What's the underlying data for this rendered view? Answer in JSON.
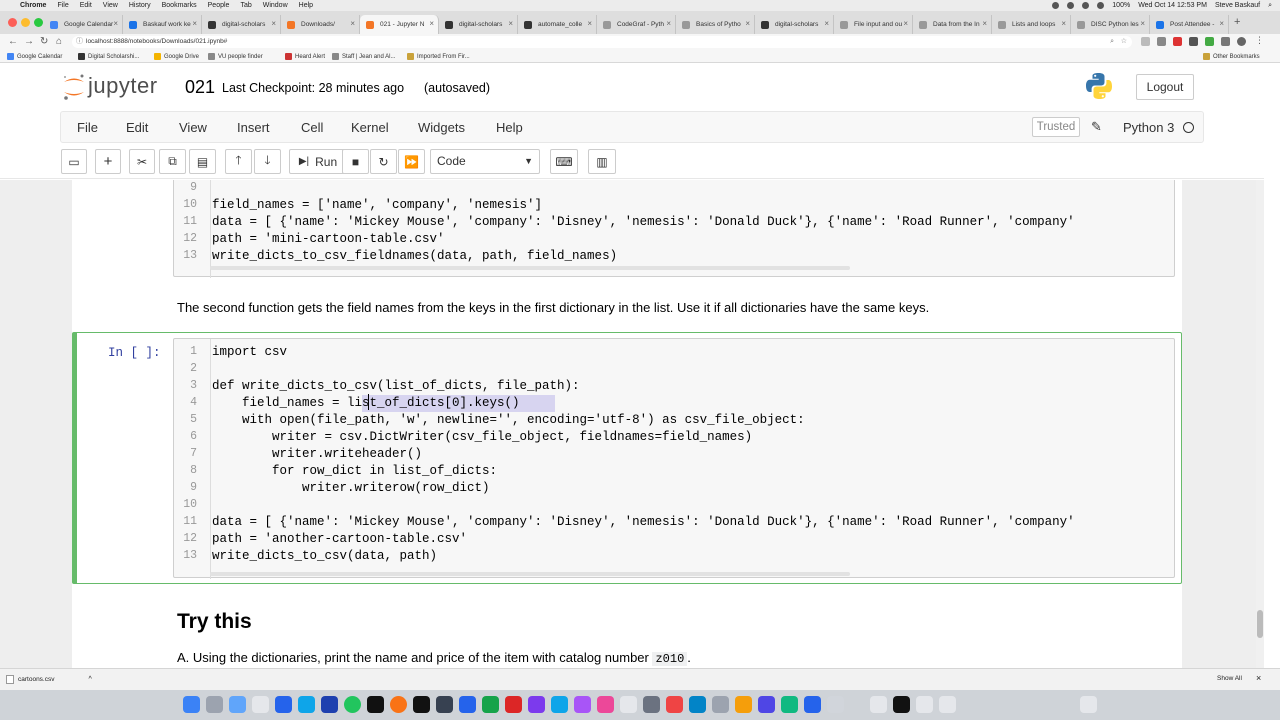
{
  "os_menubar": {
    "app": "Chrome",
    "items": [
      "File",
      "Edit",
      "View",
      "History",
      "Bookmarks",
      "People",
      "Tab",
      "Window",
      "Help"
    ],
    "battery": "100%",
    "datetime": "Wed Oct 14 12:53 PM",
    "user": "Steve Baskauf"
  },
  "tabs": [
    {
      "label": "Google Calendar"
    },
    {
      "label": "Baskauf work ke"
    },
    {
      "label": "digital-scholars"
    },
    {
      "label": "Downloads/"
    },
    {
      "label": "021 - Jupyter N"
    },
    {
      "label": "digital-scholars"
    },
    {
      "label": "automate_colle"
    },
    {
      "label": "CodeGraf - Pyth"
    },
    {
      "label": "Basics of Pytho"
    },
    {
      "label": "digital-scholars"
    },
    {
      "label": "File input and ou"
    },
    {
      "label": "Data from the In"
    },
    {
      "label": "Lists and loops"
    },
    {
      "label": "DISC Python les"
    },
    {
      "label": "Post Attendee -"
    }
  ],
  "address_bar": {
    "url": "localhost:8888/notebooks/Downloads/021.ipynb#"
  },
  "bookmarks": [
    {
      "label": "Google Calendar"
    },
    {
      "label": "Digital Scholarshi..."
    },
    {
      "label": "Google Drive"
    },
    {
      "label": "VU people finder"
    },
    {
      "label": "Heard Alert"
    },
    {
      "label": "Staff | Jean and Al..."
    },
    {
      "label": "Imported From Fir..."
    }
  ],
  "other_bookmarks": "Other Bookmarks",
  "jupyter": {
    "logo_text": "jupyter",
    "notebook_name": "021",
    "checkpoint": "Last Checkpoint: 28 minutes ago",
    "autosave": "(autosaved)",
    "logout": "Logout",
    "menu": [
      "File",
      "Edit",
      "View",
      "Insert",
      "Cell",
      "Kernel",
      "Widgets",
      "Help"
    ],
    "trusted": "Trusted",
    "kernel": "Python 3",
    "toolbar": {
      "run_label": "Run",
      "cell_type": "Code"
    }
  },
  "cells": {
    "cell1": {
      "line_numbers": [
        "9",
        "10",
        "11",
        "12",
        "13"
      ],
      "code_lines": [
        "",
        "field_names = ['name', 'company', 'nemesis']",
        "data = [ {'name': 'Mickey Mouse', 'company': 'Disney', 'nemesis': 'Donald Duck'}, {'name': 'Road Runner', 'company'",
        "path = 'mini-cartoon-table.csv'",
        "write_dicts_to_csv_fieldnames(data, path, field_names)"
      ]
    },
    "markdown1": "The second function gets the field names from the keys in the first dictionary in the list. Use it if all dictionaries have the same keys.",
    "cell2": {
      "prompt": "In [ ]:",
      "line_numbers": [
        "1",
        "2",
        "3",
        "4",
        "5",
        "6",
        "7",
        "8",
        "9",
        "10",
        "11",
        "12",
        "13"
      ],
      "code_lines": [
        "import csv",
        "",
        "def write_dicts_to_csv(list_of_dicts, file_path):",
        "    field_names = list_of_dicts[0].keys()",
        "    with open(file_path, 'w', newline='', encoding='utf-8') as csv_file_object:",
        "        writer = csv.DictWriter(csv_file_object, fieldnames=field_names)",
        "        writer.writeheader()",
        "        for row_dict in list_of_dicts:",
        "            writer.writerow(row_dict)",
        "",
        "data = [ {'name': 'Mickey Mouse', 'company': 'Disney', 'nemesis': 'Donald Duck'}, {'name': 'Road Runner', 'company'",
        "path = 'another-cartoon-table.csv'",
        "write_dicts_to_csv(data, path)"
      ]
    },
    "heading": "Try this",
    "markdown2": {
      "text": "A. Using the dictionaries, print the name and price of the item with catalog number",
      "code": "z010",
      "end": "."
    }
  },
  "download_bar": {
    "file": "cartoons.csv",
    "show_all": "Show All"
  },
  "colors": {
    "selected_cell_border": "#66bb6a",
    "keyword": "#008000",
    "string": "#ba2121",
    "def_name": "#0000ff"
  }
}
